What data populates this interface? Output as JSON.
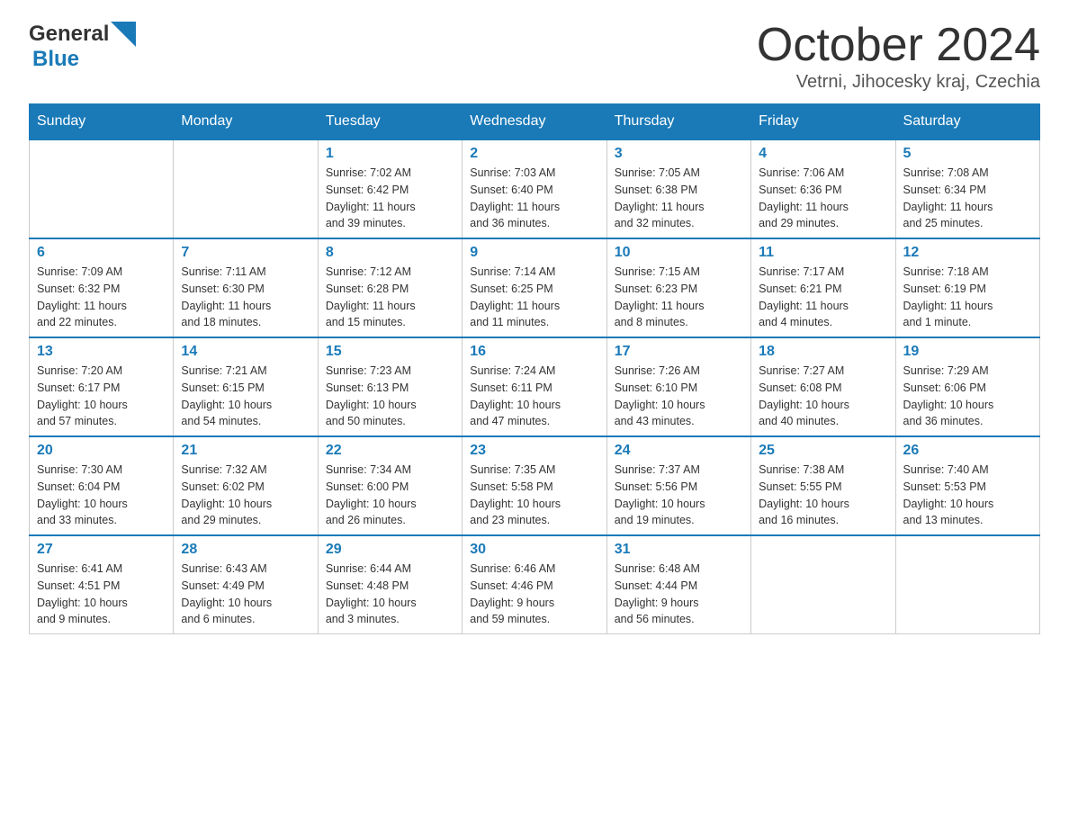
{
  "header": {
    "logo_general": "General",
    "logo_blue": "Blue",
    "month_title": "October 2024",
    "location": "Vetrni, Jihocesky kraj, Czechia"
  },
  "days_of_week": [
    "Sunday",
    "Monday",
    "Tuesday",
    "Wednesday",
    "Thursday",
    "Friday",
    "Saturday"
  ],
  "weeks": [
    [
      {
        "day": "",
        "info": ""
      },
      {
        "day": "",
        "info": ""
      },
      {
        "day": "1",
        "info": "Sunrise: 7:02 AM\nSunset: 6:42 PM\nDaylight: 11 hours\nand 39 minutes."
      },
      {
        "day": "2",
        "info": "Sunrise: 7:03 AM\nSunset: 6:40 PM\nDaylight: 11 hours\nand 36 minutes."
      },
      {
        "day": "3",
        "info": "Sunrise: 7:05 AM\nSunset: 6:38 PM\nDaylight: 11 hours\nand 32 minutes."
      },
      {
        "day": "4",
        "info": "Sunrise: 7:06 AM\nSunset: 6:36 PM\nDaylight: 11 hours\nand 29 minutes."
      },
      {
        "day": "5",
        "info": "Sunrise: 7:08 AM\nSunset: 6:34 PM\nDaylight: 11 hours\nand 25 minutes."
      }
    ],
    [
      {
        "day": "6",
        "info": "Sunrise: 7:09 AM\nSunset: 6:32 PM\nDaylight: 11 hours\nand 22 minutes."
      },
      {
        "day": "7",
        "info": "Sunrise: 7:11 AM\nSunset: 6:30 PM\nDaylight: 11 hours\nand 18 minutes."
      },
      {
        "day": "8",
        "info": "Sunrise: 7:12 AM\nSunset: 6:28 PM\nDaylight: 11 hours\nand 15 minutes."
      },
      {
        "day": "9",
        "info": "Sunrise: 7:14 AM\nSunset: 6:25 PM\nDaylight: 11 hours\nand 11 minutes."
      },
      {
        "day": "10",
        "info": "Sunrise: 7:15 AM\nSunset: 6:23 PM\nDaylight: 11 hours\nand 8 minutes."
      },
      {
        "day": "11",
        "info": "Sunrise: 7:17 AM\nSunset: 6:21 PM\nDaylight: 11 hours\nand 4 minutes."
      },
      {
        "day": "12",
        "info": "Sunrise: 7:18 AM\nSunset: 6:19 PM\nDaylight: 11 hours\nand 1 minute."
      }
    ],
    [
      {
        "day": "13",
        "info": "Sunrise: 7:20 AM\nSunset: 6:17 PM\nDaylight: 10 hours\nand 57 minutes."
      },
      {
        "day": "14",
        "info": "Sunrise: 7:21 AM\nSunset: 6:15 PM\nDaylight: 10 hours\nand 54 minutes."
      },
      {
        "day": "15",
        "info": "Sunrise: 7:23 AM\nSunset: 6:13 PM\nDaylight: 10 hours\nand 50 minutes."
      },
      {
        "day": "16",
        "info": "Sunrise: 7:24 AM\nSunset: 6:11 PM\nDaylight: 10 hours\nand 47 minutes."
      },
      {
        "day": "17",
        "info": "Sunrise: 7:26 AM\nSunset: 6:10 PM\nDaylight: 10 hours\nand 43 minutes."
      },
      {
        "day": "18",
        "info": "Sunrise: 7:27 AM\nSunset: 6:08 PM\nDaylight: 10 hours\nand 40 minutes."
      },
      {
        "day": "19",
        "info": "Sunrise: 7:29 AM\nSunset: 6:06 PM\nDaylight: 10 hours\nand 36 minutes."
      }
    ],
    [
      {
        "day": "20",
        "info": "Sunrise: 7:30 AM\nSunset: 6:04 PM\nDaylight: 10 hours\nand 33 minutes."
      },
      {
        "day": "21",
        "info": "Sunrise: 7:32 AM\nSunset: 6:02 PM\nDaylight: 10 hours\nand 29 minutes."
      },
      {
        "day": "22",
        "info": "Sunrise: 7:34 AM\nSunset: 6:00 PM\nDaylight: 10 hours\nand 26 minutes."
      },
      {
        "day": "23",
        "info": "Sunrise: 7:35 AM\nSunset: 5:58 PM\nDaylight: 10 hours\nand 23 minutes."
      },
      {
        "day": "24",
        "info": "Sunrise: 7:37 AM\nSunset: 5:56 PM\nDaylight: 10 hours\nand 19 minutes."
      },
      {
        "day": "25",
        "info": "Sunrise: 7:38 AM\nSunset: 5:55 PM\nDaylight: 10 hours\nand 16 minutes."
      },
      {
        "day": "26",
        "info": "Sunrise: 7:40 AM\nSunset: 5:53 PM\nDaylight: 10 hours\nand 13 minutes."
      }
    ],
    [
      {
        "day": "27",
        "info": "Sunrise: 6:41 AM\nSunset: 4:51 PM\nDaylight: 10 hours\nand 9 minutes."
      },
      {
        "day": "28",
        "info": "Sunrise: 6:43 AM\nSunset: 4:49 PM\nDaylight: 10 hours\nand 6 minutes."
      },
      {
        "day": "29",
        "info": "Sunrise: 6:44 AM\nSunset: 4:48 PM\nDaylight: 10 hours\nand 3 minutes."
      },
      {
        "day": "30",
        "info": "Sunrise: 6:46 AM\nSunset: 4:46 PM\nDaylight: 9 hours\nand 59 minutes."
      },
      {
        "day": "31",
        "info": "Sunrise: 6:48 AM\nSunset: 4:44 PM\nDaylight: 9 hours\nand 56 minutes."
      },
      {
        "day": "",
        "info": ""
      },
      {
        "day": "",
        "info": ""
      }
    ]
  ]
}
